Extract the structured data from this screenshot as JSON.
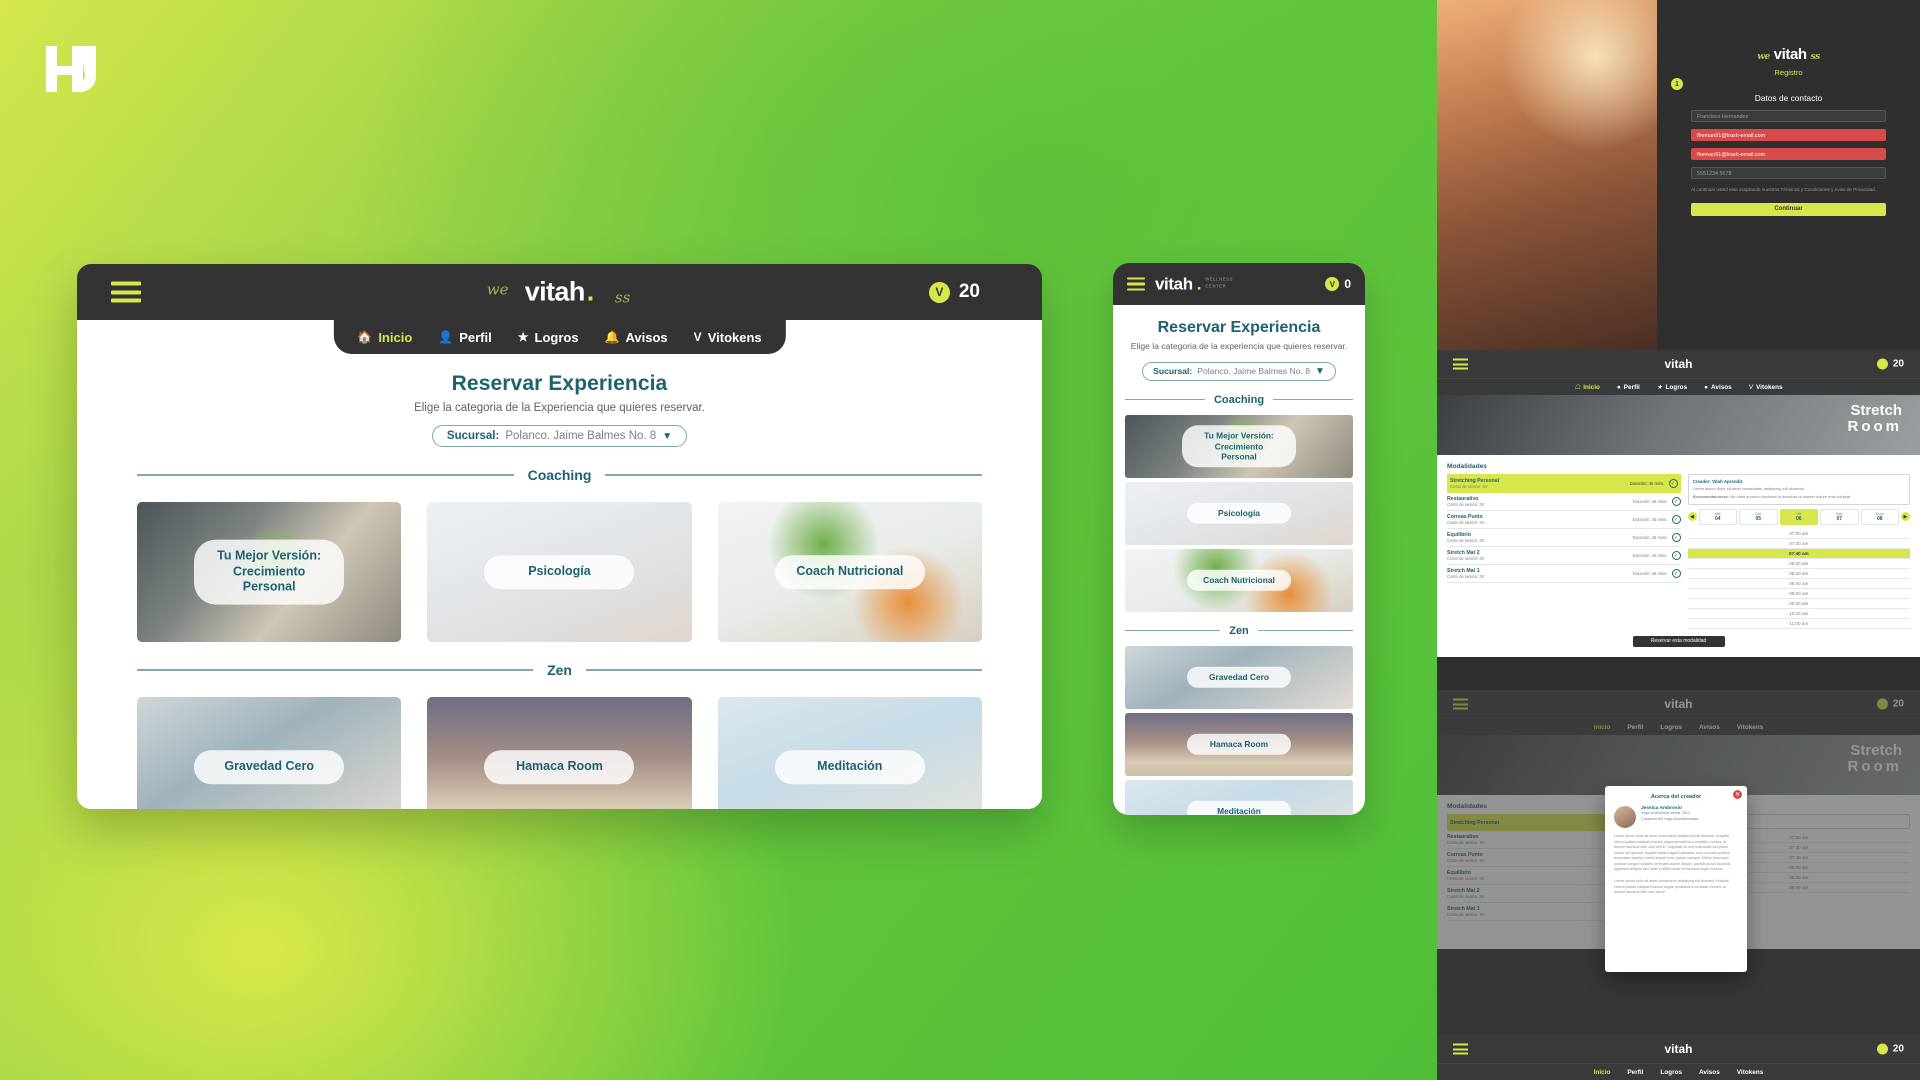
{
  "brand": {
    "name": "vitah",
    "dot": ".",
    "script_left": "we",
    "script_right": "ss",
    "tagline": "WELLNESS CENTER",
    "accent_lime": "#d7e64b",
    "accent_teal": "#1d6270",
    "dark": "#333333"
  },
  "desktop": {
    "topbar": {
      "menu_icon": "hamburger-icon",
      "token_symbol": "V",
      "token_count": "20"
    },
    "nav": [
      {
        "label": "Inicio",
        "icon": "home-icon",
        "active": true
      },
      {
        "label": "Perfil",
        "icon": "person-icon",
        "active": false
      },
      {
        "label": "Logros",
        "icon": "star-badge-icon",
        "active": false
      },
      {
        "label": "Avisos",
        "icon": "bell-icon",
        "active": false
      },
      {
        "label": "Vitokens",
        "icon": "v-token-icon",
        "active": false
      }
    ],
    "page_title": "Reservar Experiencia",
    "page_subtitle": "Elige la categoria de la Experiencia que quieres reservar.",
    "sucursal": {
      "label": "Sucursal:",
      "value": "Polanco. Jaime Balmes No. 8",
      "caret": "▼"
    },
    "sections": [
      {
        "title": "Coaching",
        "cards": [
          {
            "label": "Tu Mejor Versión:\nCrecimiento Personal",
            "photo": "ph-growth"
          },
          {
            "label": "Psicología",
            "photo": "ph-psico"
          },
          {
            "label": "Coach Nutricional",
            "photo": "ph-nutri"
          }
        ]
      },
      {
        "title": "Zen",
        "cards": [
          {
            "label": "Gravedad Cero",
            "photo": "ph-grav"
          },
          {
            "label": "Hamaca Room",
            "photo": "ph-hamaca"
          },
          {
            "label": "Meditación",
            "photo": "ph-medit"
          }
        ]
      }
    ]
  },
  "phone": {
    "topbar": {
      "token_symbol": "V",
      "token_count": "0",
      "tagline": "WELLNESS\nCENTER"
    },
    "page_title": "Reservar Experiencia",
    "page_subtitle": "Elige la categoria de la experiencia que quieres reservar.",
    "sucursal": {
      "label": "Sucursal:",
      "value": "Polanco. Jaime Balmes No. 8",
      "caret": "▼"
    },
    "sections": [
      {
        "title": "Coaching",
        "cards": [
          {
            "label": "Tu Mejor Versión:\nCrecimiento Personal",
            "photo": "ph-growth"
          },
          {
            "label": "Psicología",
            "photo": "ph-psico"
          },
          {
            "label": "Coach Nutricional",
            "photo": "ph-nutri"
          }
        ]
      },
      {
        "title": "Zen",
        "cards": [
          {
            "label": "Gravedad Cero",
            "photo": "ph-grav"
          },
          {
            "label": "Hamaca Room",
            "photo": "ph-hamaca"
          },
          {
            "label": "Meditación",
            "photo": "ph-medit"
          }
        ]
      }
    ]
  },
  "registration": {
    "step": "1",
    "logo": "vitah",
    "title": "Registro",
    "section_label": "Datos de contacto",
    "fields": [
      {
        "value": "Francisco Hernandez",
        "state": "normal"
      },
      {
        "value": "fhernan91@trash-email.com",
        "state": "error"
      },
      {
        "value": "fhernan91@trash-email.com",
        "state": "error"
      },
      {
        "value": "5551234 5678",
        "state": "normal"
      }
    ],
    "legal": "Al continuar usted esta aceptando nuestros Términos y Condiciones y Aviso de Privacidad.",
    "cta": "Continuar"
  },
  "booking": {
    "topbar": {
      "token_symbol": "V",
      "token_count": "20"
    },
    "nav": [
      {
        "label": "Inicio",
        "icon": "home-icon",
        "active": true
      },
      {
        "label": "Perfil",
        "icon": "person-icon",
        "active": false
      },
      {
        "label": "Logros",
        "icon": "star-badge-icon",
        "active": false
      },
      {
        "label": "Avisos",
        "icon": "bell-icon",
        "active": false
      },
      {
        "label": "Vitokens",
        "icon": "v-token-icon",
        "active": false
      }
    ],
    "hero_title_line1": "Stretch",
    "hero_title_line2": "Room",
    "section_title": "Modalidades",
    "rows": [
      {
        "name": "Stretching Personal",
        "meta": "Costo de sesión: 3V",
        "duration": "Duración: 45 mins.",
        "selected": true
      },
      {
        "name": "Restaurativo",
        "meta": "Costo de sesión: 3V",
        "duration": "Duración: 45 mins.",
        "selected": false
      },
      {
        "name": "Correas Punto",
        "meta": "Costo de sesión: 3V",
        "duration": "Duración: 45 mins.",
        "selected": false
      },
      {
        "name": "Equilibrio",
        "meta": "Costo de sesión: 3V",
        "duration": "Duración: 45 mins.",
        "selected": false
      },
      {
        "name": "Stretch Mat 2",
        "meta": "Costo de sesión: 3V",
        "duration": "Duración: 45 mins.",
        "selected": false
      },
      {
        "name": "Stretch Mat 1",
        "meta": "Costo de sesión: 3V",
        "duration": "Duración: 45 mins.",
        "selected": false
      }
    ],
    "info": {
      "creator_label": "Creador:",
      "creator_value": "Vitah Aprendiz",
      "line2": "Lorem ipsum dolor sit amet consectetur adipiscing elit dictumst.",
      "recommend_label": "Recomendaciones:",
      "recommend_value": "No valet quomod tincidunt ut tincidunt ut laoreet dolore erat volutpat."
    },
    "days": [
      {
        "dow": "Mie",
        "num": "04",
        "on": false
      },
      {
        "dow": "Jue",
        "num": "05",
        "on": false
      },
      {
        "dow": "Vie",
        "num": "06",
        "on": true
      },
      {
        "dow": "Sab",
        "num": "07",
        "on": false
      },
      {
        "dow": "Dom",
        "num": "08",
        "on": false
      }
    ],
    "prev_arrow": "◀",
    "next_arrow": "▶",
    "slots": [
      {
        "time": "07:00 am",
        "on": false
      },
      {
        "time": "07:20 am",
        "on": false
      },
      {
        "time": "07:40 am",
        "on": true
      },
      {
        "time": "08:00 am",
        "on": false
      },
      {
        "time": "08:20 am",
        "on": false
      },
      {
        "time": "08:40 am",
        "on": false
      },
      {
        "time": "09:00 am",
        "on": false
      },
      {
        "time": "09:30 am",
        "on": false
      },
      {
        "time": "10:15 am",
        "on": false
      },
      {
        "time": "11:00 am",
        "on": false
      }
    ],
    "cta": "Reservar esta modalidad"
  },
  "creator_modal": {
    "title": "Acerca del creador",
    "name": "Jessica Ambrosio",
    "role": "Yoga profesional desde 2012.",
    "role2": "Creadora del Yoga Acondicionado.",
    "paragraph1": "Lorem ipsum dolor sit amet consectetur adipiscing elit dictumst. Hospital viverra platea volutpat rhoncus augue penatibus a curabitur montes, at laoreet faucibus nibh odio sed in. Vulputate sit sed sollicitudin est ipsum ornare dui gravida, feugiat mattis magna habitasse mus convalis porttitor, accumsan dapibus luctus aliquet nunc classe natoque. Metus commodo pulvinar congue sodales venenatis auctor aliquet, gravida luctus faucibus dignissim tempus sed, diam porttitor quae fermentum turpis rhoncus.",
    "paragraph2": "Lorem ipsum dolor sit amet consectetur adipiscing elit dictumst. Hospital viverra platea volutpat rhoncus augue penatibus a curabitur montes, at laoreet faucibus nibh odio sed in.",
    "close_icon": "close-icon"
  },
  "bottom_bar": {
    "token_symbol": "V",
    "token_count": "20"
  }
}
